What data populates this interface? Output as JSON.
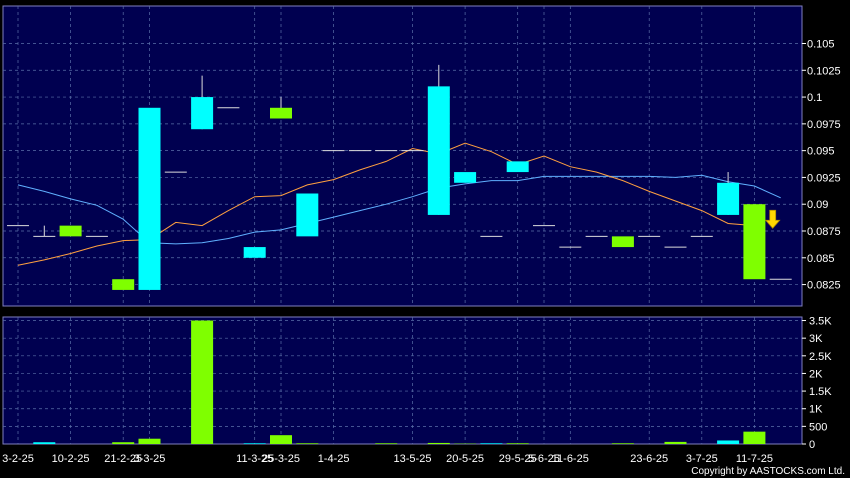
{
  "chart_data": [
    {
      "type": "candlestick",
      "panel": "price",
      "colors": {
        "background": "#000050",
        "grid": "#5a6fa8",
        "up": "#7fff00",
        "down": "#00ffff",
        "ma_fast": "#ffa040",
        "ma_slow": "#60b0ff",
        "arrow": "#ffd700"
      },
      "ylim": [
        0.0805,
        0.1085
      ],
      "y_ticks": [
        "0.105",
        "0.1025",
        "0.1",
        "0.0975",
        "0.095",
        "0.0925",
        "0.09",
        "0.0875",
        "0.085",
        "0.0825"
      ],
      "y_tick_values": [
        0.105,
        0.1025,
        0.1,
        0.0975,
        0.095,
        0.0925,
        0.09,
        0.0875,
        0.085,
        0.0825
      ],
      "candles": [
        {
          "o": 0.088,
          "h": 0.088,
          "l": 0.088,
          "c": 0.088
        },
        {
          "o": 0.087,
          "h": 0.088,
          "l": 0.087,
          "c": 0.087
        },
        {
          "o": 0.087,
          "h": 0.088,
          "l": 0.087,
          "c": 0.088
        },
        {
          "o": 0.087,
          "h": 0.087,
          "l": 0.087,
          "c": 0.087
        },
        {
          "o": 0.082,
          "h": 0.083,
          "l": 0.082,
          "c": 0.083
        },
        {
          "o": 0.099,
          "h": 0.099,
          "l": 0.082,
          "c": 0.082
        },
        {
          "o": 0.093,
          "h": 0.093,
          "l": 0.093,
          "c": 0.093
        },
        {
          "o": 0.1,
          "h": 0.102,
          "l": 0.097,
          "c": 0.097
        },
        {
          "o": 0.099,
          "h": 0.099,
          "l": 0.099,
          "c": 0.099
        },
        {
          "o": 0.086,
          "h": 0.086,
          "l": 0.085,
          "c": 0.085
        },
        {
          "o": 0.098,
          "h": 0.1,
          "l": 0.098,
          "c": 0.099
        },
        {
          "o": 0.091,
          "h": 0.091,
          "l": 0.087,
          "c": 0.087
        },
        {
          "o": 0.095,
          "h": 0.095,
          "l": 0.095,
          "c": 0.095
        },
        {
          "o": 0.095,
          "h": 0.095,
          "l": 0.095,
          "c": 0.095
        },
        {
          "o": 0.095,
          "h": 0.095,
          "l": 0.095,
          "c": 0.095
        },
        {
          "o": 0.095,
          "h": 0.095,
          "l": 0.095,
          "c": 0.095
        },
        {
          "o": 0.101,
          "h": 0.103,
          "l": 0.089,
          "c": 0.089
        },
        {
          "o": 0.093,
          "h": 0.093,
          "l": 0.092,
          "c": 0.092
        },
        {
          "o": 0.087,
          "h": 0.087,
          "l": 0.087,
          "c": 0.087
        },
        {
          "o": 0.094,
          "h": 0.094,
          "l": 0.093,
          "c": 0.093
        },
        {
          "o": 0.088,
          "h": 0.088,
          "l": 0.088,
          "c": 0.088
        },
        {
          "o": 0.086,
          "h": 0.086,
          "l": 0.086,
          "c": 0.086
        },
        {
          "o": 0.087,
          "h": 0.087,
          "l": 0.087,
          "c": 0.087
        },
        {
          "o": 0.086,
          "h": 0.087,
          "l": 0.086,
          "c": 0.087
        },
        {
          "o": 0.087,
          "h": 0.087,
          "l": 0.087,
          "c": 0.087
        },
        {
          "o": 0.086,
          "h": 0.086,
          "l": 0.086,
          "c": 0.086
        },
        {
          "o": 0.087,
          "h": 0.087,
          "l": 0.087,
          "c": 0.087
        },
        {
          "o": 0.092,
          "h": 0.093,
          "l": 0.089,
          "c": 0.089
        },
        {
          "o": 0.083,
          "h": 0.09,
          "l": 0.083,
          "c": 0.09
        },
        {
          "o": 0.083,
          "h": 0.083,
          "l": 0.083,
          "c": 0.083
        }
      ],
      "ma_fast": [
        0.0843,
        0.0848,
        0.0854,
        0.0861,
        0.0866,
        0.0867,
        0.0883,
        0.088,
        0.0894,
        0.0907,
        0.0908,
        0.0918,
        0.0923,
        0.0932,
        0.094,
        0.0952,
        0.0947,
        0.0957,
        0.0949,
        0.0937,
        0.0945,
        0.0935,
        0.093,
        0.0922,
        0.0912,
        0.0903,
        0.0894,
        0.0882,
        0.088,
        null
      ],
      "ma_slow": [
        0.0918,
        0.0912,
        0.0905,
        0.0899,
        0.0886,
        0.0864,
        0.0863,
        0.0864,
        0.0868,
        0.0874,
        0.0876,
        0.0882,
        0.0888,
        0.0894,
        0.09,
        0.0907,
        0.0915,
        0.0919,
        0.0922,
        0.0922,
        0.0926,
        0.0926,
        0.0926,
        0.0926,
        0.0926,
        0.0925,
        0.0927,
        0.0921,
        0.0917,
        0.0906
      ],
      "arrow_index": 29
    },
    {
      "type": "bar",
      "panel": "volume",
      "ylim": [
        0,
        3600
      ],
      "y_ticks": [
        "3.5K",
        "3K",
        "2.5K",
        "2K",
        "1.5K",
        "1K",
        "500",
        "0"
      ],
      "y_tick_values": [
        3500,
        3000,
        2500,
        2000,
        1500,
        1000,
        500,
        0
      ],
      "values": [
        0,
        50,
        0,
        0,
        50,
        150,
        0,
        3500,
        0,
        20,
        250,
        20,
        0,
        0,
        20,
        0,
        30,
        10,
        20,
        20,
        0,
        0,
        0,
        20,
        0,
        60,
        0,
        100,
        350,
        0
      ],
      "colors_by_index": [
        "up",
        "down",
        "up",
        "down",
        "up",
        "up",
        "down",
        "up",
        "down",
        "down",
        "up",
        "up",
        "up",
        "down",
        "up",
        "up",
        "up",
        "up",
        "down",
        "up",
        "up",
        "down",
        "up",
        "up",
        "down",
        "up",
        "down",
        "down",
        "up",
        "up"
      ]
    }
  ],
  "x_axis": {
    "labels": [
      {
        "text": "3-2-25",
        "i": 0
      },
      {
        "text": "10-2-25",
        "i": 2
      },
      {
        "text": "21-2-25",
        "i": 4
      },
      {
        "text": "3-3-25",
        "i": 5
      },
      {
        "text": "11-3-25",
        "i": 9
      },
      {
        "text": "25-3-25",
        "i": 10
      },
      {
        "text": "1-4-25",
        "i": 12
      },
      {
        "text": "13-5-25",
        "i": 15
      },
      {
        "text": "20-5-25",
        "i": 17
      },
      {
        "text": "29-5-25",
        "i": 19
      },
      {
        "text": "5-6-25",
        "i": 20
      },
      {
        "text": "11-6-25",
        "i": 21
      },
      {
        "text": "23-6-25",
        "i": 24
      },
      {
        "text": "3-7-25",
        "i": 26
      },
      {
        "text": "11-7-25",
        "i": 28
      }
    ]
  },
  "copyright": "Copyright by AASTOCKS.com Ltd."
}
